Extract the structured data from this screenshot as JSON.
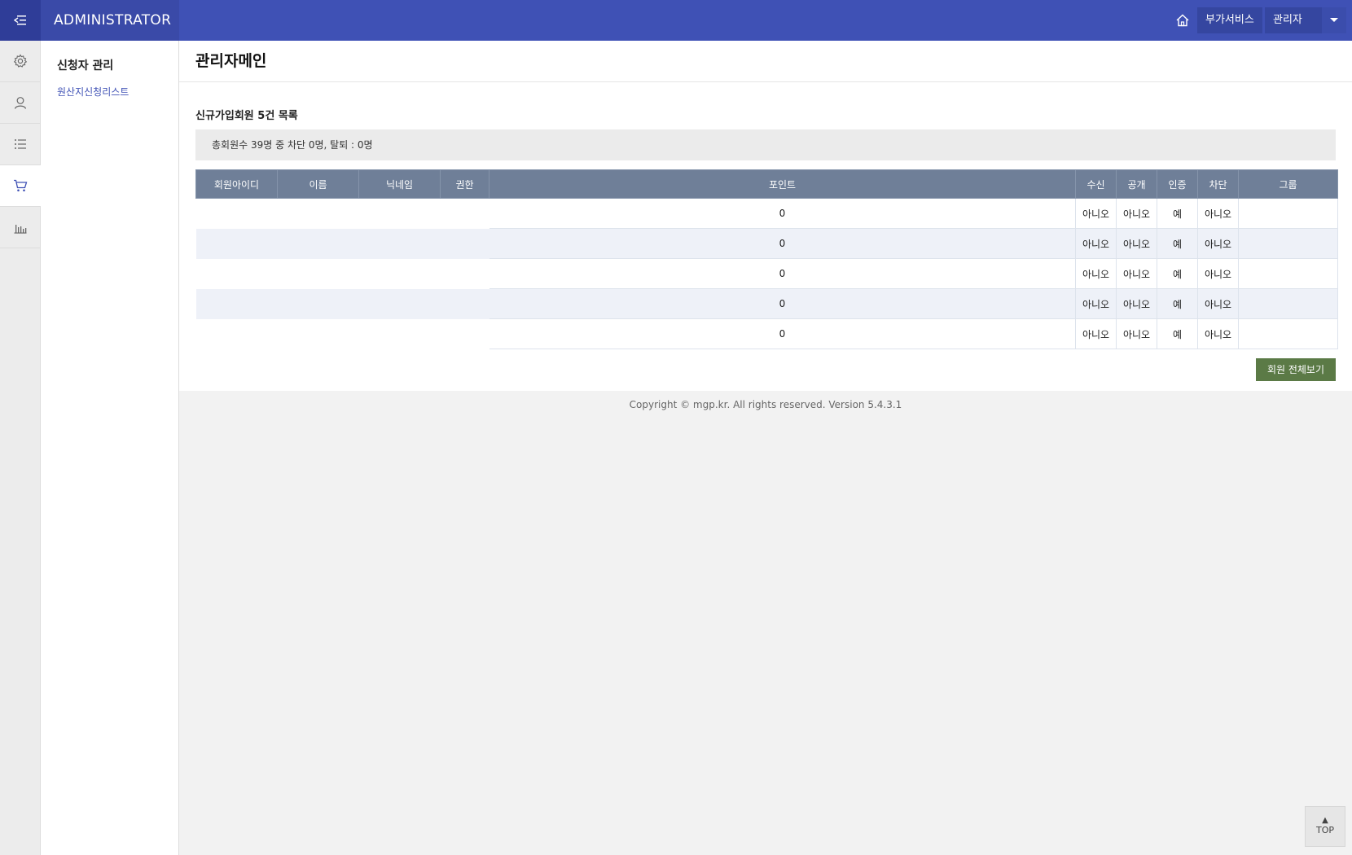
{
  "header": {
    "brand": "ADMINISTRATOR",
    "service_label": "부가서비스",
    "admin_label": "관리자",
    "color": "#3f51b5"
  },
  "rail": {
    "icons": [
      "gear-icon",
      "user-icon",
      "list-icon",
      "cart-icon",
      "bar-chart-icon"
    ],
    "active_index": 3
  },
  "submenu": {
    "title": "신청자 관리",
    "link": "원산지신청리스트"
  },
  "main": {
    "page_title": "관리자메인",
    "section_title": "신규가입회원 5건 목록",
    "summary": "총회원수 39명 중 차단 0명, 탈퇴 : 0명",
    "columns": [
      "회원아이디",
      "이름",
      "닉네임",
      "권한",
      "포인트",
      "수신",
      "공개",
      "인증",
      "차단",
      "그룹"
    ],
    "rows": [
      {
        "id": "",
        "name": "",
        "nick": "",
        "level": "",
        "point": "0",
        "recv": "아니오",
        "open": "아니오",
        "cert": "예",
        "block": "아니오",
        "group": ""
      },
      {
        "id": "",
        "name": "",
        "nick": "",
        "level": "",
        "point": "0",
        "recv": "아니오",
        "open": "아니오",
        "cert": "예",
        "block": "아니오",
        "group": ""
      },
      {
        "id": "",
        "name": "",
        "nick": "",
        "level": "",
        "point": "0",
        "recv": "아니오",
        "open": "아니오",
        "cert": "예",
        "block": "아니오",
        "group": ""
      },
      {
        "id": "",
        "name": "",
        "nick": "",
        "level": "",
        "point": "0",
        "recv": "아니오",
        "open": "아니오",
        "cert": "예",
        "block": "아니오",
        "group": ""
      },
      {
        "id": "",
        "name": "",
        "nick": "",
        "level": "",
        "point": "0",
        "recv": "아니오",
        "open": "아니오",
        "cert": "예",
        "block": "아니오",
        "group": ""
      }
    ],
    "view_all_label": "회원 전체보기"
  },
  "footer": {
    "copyright": "Copyright © mgp.kr. All rights reserved. Version 5.4.3.1"
  },
  "top_button": "TOP"
}
